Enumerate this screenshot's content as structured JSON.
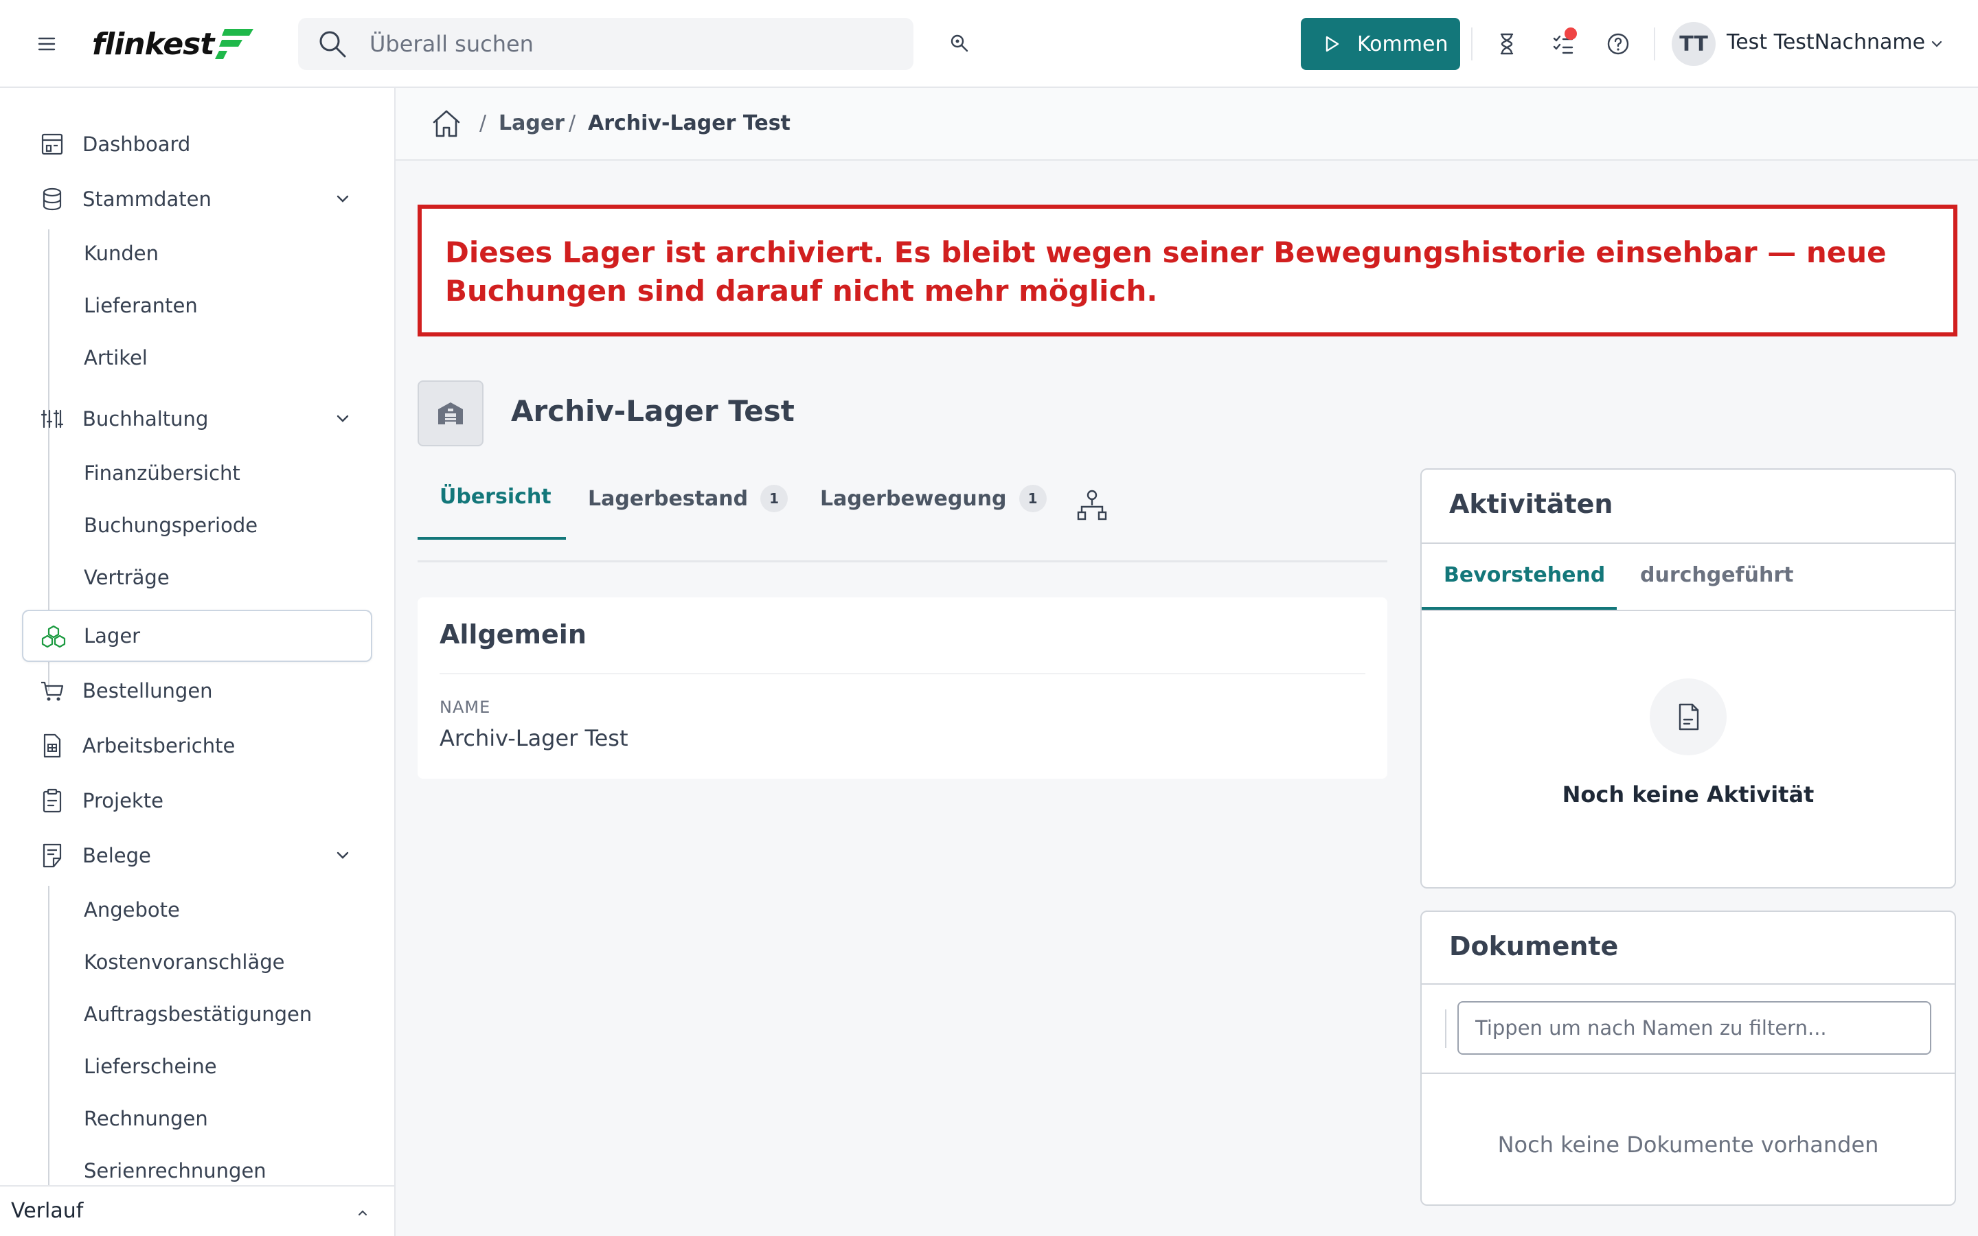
{
  "header": {
    "logo_text": "flinkest",
    "search_placeholder": "Überall suchen",
    "kommen_label": "Kommen",
    "user_initials": "TT",
    "user_name": "Test TestNachname",
    "accent_color": "#13777a"
  },
  "sidebar": {
    "items": [
      {
        "label": "Dashboard",
        "icon": "dashboard-icon"
      },
      {
        "label": "Stammdaten",
        "icon": "database-icon",
        "children": [
          "Kunden",
          "Lieferanten",
          "Artikel"
        ]
      },
      {
        "label": "Buchhaltung",
        "icon": "sliders-icon",
        "children": [
          "Finanzübersicht",
          "Buchungsperiode",
          "Verträge"
        ]
      },
      {
        "label": "Lager",
        "icon": "boxes-icon",
        "active": true
      },
      {
        "label": "Bestellungen",
        "icon": "cart-icon"
      },
      {
        "label": "Arbeitsberichte",
        "icon": "report-icon"
      },
      {
        "label": "Projekte",
        "icon": "clipboard-icon"
      },
      {
        "label": "Belege",
        "icon": "receipt-icon",
        "children": [
          "Angebote",
          "Kostenvoranschläge",
          "Auftragsbestätigungen",
          "Lieferscheine",
          "Rechnungen",
          "Serienrechnungen"
        ]
      }
    ],
    "verlauf_label": "Verlauf"
  },
  "breadcrumb": {
    "items": [
      "Lager",
      "Archiv-Lager Test"
    ],
    "separator": "/"
  },
  "alert": {
    "text": "Dieses Lager ist archiviert. Es bleibt wegen seiner Bewegungshistorie einsehbar — neue Buchungen sind darauf nicht mehr möglich.",
    "color": "#d11f1f"
  },
  "page": {
    "title": "Archiv-Lager Test",
    "tabs": [
      {
        "label": "Übersicht",
        "active": true
      },
      {
        "label": "Lagerbestand",
        "count": "1"
      },
      {
        "label": "Lagerbewegung",
        "count": "1"
      }
    ]
  },
  "general": {
    "heading": "Allgemein",
    "name_label": "NAME",
    "name_value": "Archiv-Lager Test"
  },
  "activities": {
    "heading": "Aktivitäten",
    "tabs": [
      "Bevorstehend",
      "durchgeführt"
    ],
    "empty_text": "Noch keine Aktivität"
  },
  "documents": {
    "heading": "Dokumente",
    "filter_placeholder": "Tippen um nach Namen zu filtern...",
    "empty_text": "Noch keine Dokumente vorhanden"
  }
}
